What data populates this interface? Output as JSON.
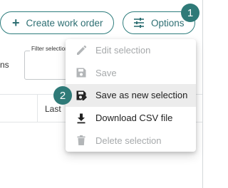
{
  "toolbar": {
    "create_label": "Create work order",
    "options_label": "Options"
  },
  "filters": {
    "partial_label": "ns",
    "filter_field_label": "Filter selection"
  },
  "table": {
    "partial_header": "Last"
  },
  "callouts": [
    "1",
    "2"
  ],
  "options_menu": {
    "items": [
      {
        "label": "Edit selection",
        "icon": "pencil-icon",
        "enabled": false
      },
      {
        "label": "Save",
        "icon": "save-icon",
        "enabled": false
      },
      {
        "label": "Save as new selection",
        "icon": "save-as-icon",
        "enabled": true,
        "highlighted": true
      },
      {
        "label": "Download CSV file",
        "icon": "download-icon",
        "enabled": true
      },
      {
        "label": "Delete selection",
        "icon": "trash-icon",
        "enabled": false
      }
    ]
  },
  "colors": {
    "accent": "#2e7d7d",
    "marker": "#2f7a78",
    "disabled_text": "#a6a9ab",
    "highlight_bg": "#ececec"
  }
}
